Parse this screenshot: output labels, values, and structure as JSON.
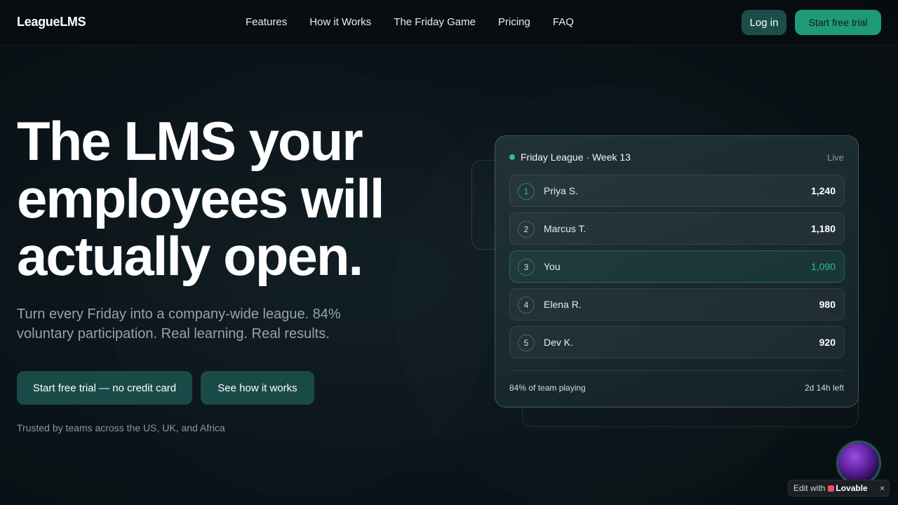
{
  "brand": {
    "name": "LeagueLMS"
  },
  "nav": {
    "links": [
      "Features",
      "How it Works",
      "The Friday Game",
      "Pricing",
      "FAQ"
    ],
    "login_label": "Log in",
    "trial_label": "Start free trial"
  },
  "hero": {
    "title_lines": [
      "The LMS your",
      "employees will",
      "actually open."
    ],
    "subtitle": "Turn every Friday into a company-wide league. 84% voluntary participation. Real learning. Real results.",
    "primary_cta": "Start free trial — no credit card",
    "secondary_cta": "See how it works",
    "trusted": "Trusted by teams across the US, UK, and Africa"
  },
  "league": {
    "title": "Friday League · Week 13",
    "status": "Live",
    "rows": [
      {
        "rank": "1",
        "name": "Priya S.",
        "score": "1,240"
      },
      {
        "rank": "2",
        "name": "Marcus T.",
        "score": "1,180"
      },
      {
        "rank": "3",
        "name": "You",
        "score": "1,090"
      },
      {
        "rank": "4",
        "name": "Elena R.",
        "score": "980"
      },
      {
        "rank": "5",
        "name": "Dev K.",
        "score": "920"
      }
    ],
    "participation": "84% of team playing",
    "time_left": "2d 14h left"
  },
  "badge": {
    "prefix": "Edit with",
    "brand": "Lovable",
    "close": "×"
  },
  "colors": {
    "accent": "#2fbf8a",
    "button_dark": "#1a4a48",
    "button_bright": "#1f9a78"
  }
}
